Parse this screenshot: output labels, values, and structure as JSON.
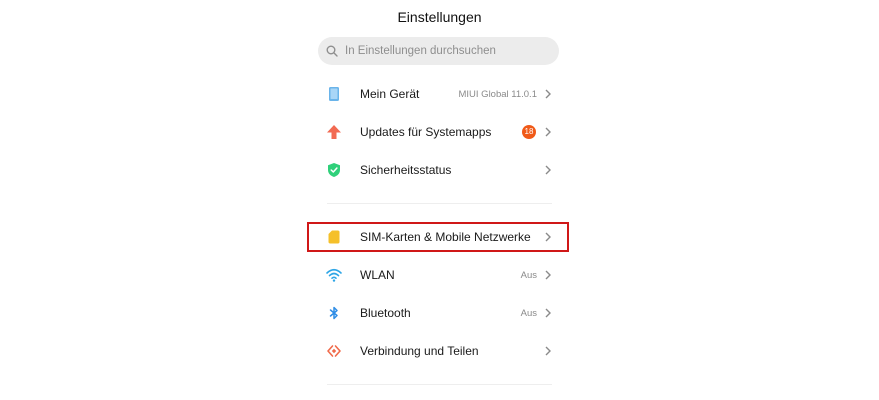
{
  "header": {
    "title": "Einstellungen"
  },
  "search": {
    "placeholder": "In Einstellungen durchsuchen",
    "icon": "search-icon"
  },
  "section1": {
    "items": [
      {
        "label": "Mein Gerät",
        "value": "MIUI Global 11.0.1",
        "icon": "tablet-icon",
        "color": "#6ab4ea"
      },
      {
        "label": "Updates für Systemapps",
        "badge": "18",
        "icon": "arrow-up-icon",
        "color": "#f26a52"
      },
      {
        "label": "Sicherheitsstatus",
        "icon": "shield-check-icon",
        "color": "#2fd07a"
      }
    ]
  },
  "section2": {
    "items": [
      {
        "label": "SIM-Karten & Mobile Netzwerke",
        "icon": "sim-card-icon",
        "color": "#f5c02a"
      },
      {
        "label": "WLAN",
        "value": "Aus",
        "icon": "wifi-icon",
        "color": "#2fa6e6"
      },
      {
        "label": "Bluetooth",
        "value": "Aus",
        "icon": "bluetooth-icon",
        "color": "#2f8de6"
      },
      {
        "label": "Verbindung und Teilen",
        "icon": "share-connection-icon",
        "color": "#f06a4a"
      }
    ]
  },
  "colors": {
    "badge": "#f05a18",
    "highlight": "#d01818"
  }
}
